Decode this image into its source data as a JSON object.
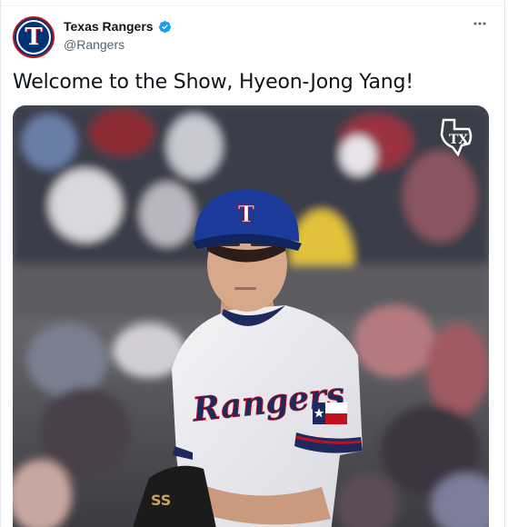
{
  "tweet": {
    "author_name": "Texas Rangers",
    "author_handle": "@Rangers",
    "avatar_letter": "T",
    "verified_icon": "verified-badge-icon",
    "more_icon": "more-icon",
    "text": "Welcome to the Show, Hyeon-Jong Yang!"
  },
  "media": {
    "type": "video",
    "jersey_text": "Rangers",
    "cap_letter": "T",
    "watermark": "TX",
    "accent": "#003278",
    "brand_red": "#c0111f"
  }
}
